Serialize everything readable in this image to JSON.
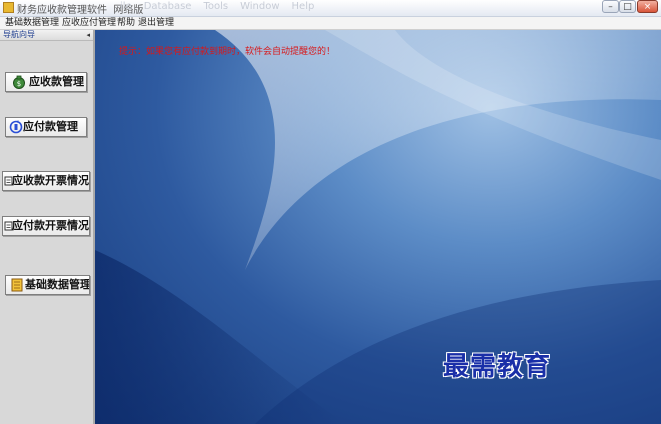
{
  "window": {
    "title": "财务应收款管理软件",
    "edition": "网络版",
    "ghost_menu": [
      "ile",
      "Database",
      "Tools",
      "Window",
      "Help"
    ],
    "buttons": {
      "minimize": "–",
      "maximize": "□",
      "close": "×"
    }
  },
  "menubar": {
    "items": [
      "基础数据管理",
      "应收应付管理",
      "帮助",
      "退出管理"
    ]
  },
  "sidebar": {
    "title": "导航向导",
    "collapse": "◂",
    "items": [
      {
        "label": "应收款管理",
        "icon": "money-bag-icon"
      },
      {
        "label": "应付款管理",
        "icon": "payment-cycle-icon"
      },
      {
        "label": "应收款开票情况",
        "icon": "invoice-icon"
      },
      {
        "label": "应付款开票情况",
        "icon": "invoice-icon"
      },
      {
        "label": "基础数据管理",
        "icon": "notebook-icon"
      }
    ]
  },
  "main": {
    "notice": "提示：如果您有应付款到期时，软件会自动提醒您的！"
  },
  "watermark": "最需教育",
  "colors": {
    "notice": "#d8181a",
    "watermark": "#1a2fa8",
    "sidebar_title": "#1e3d8f"
  }
}
